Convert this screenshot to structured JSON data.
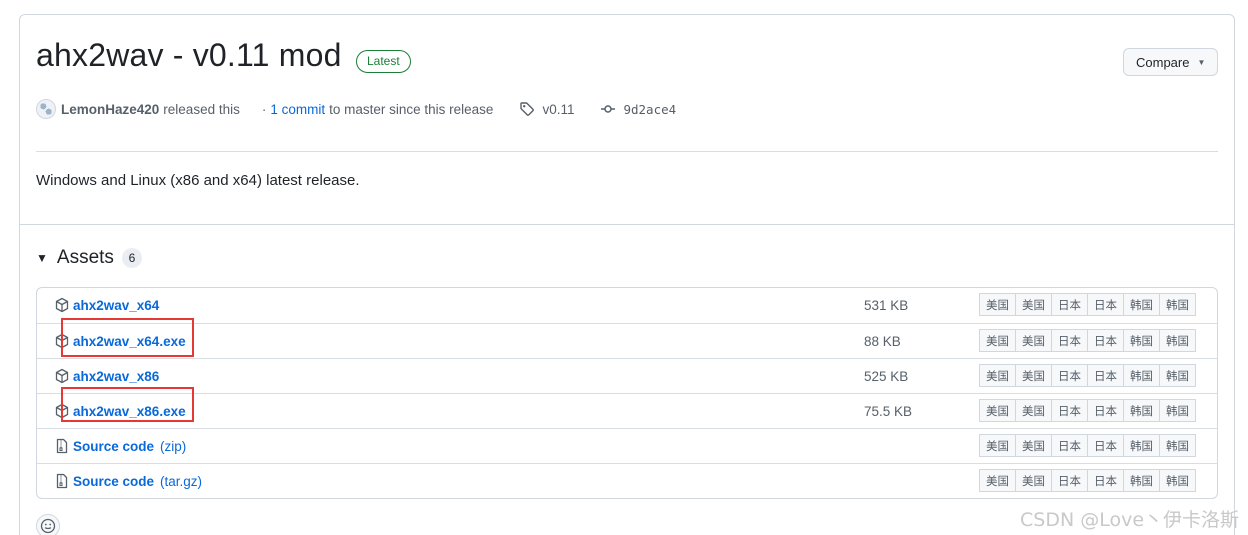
{
  "release": {
    "title": "ahx2wav - v0.11 mod",
    "badge": "Latest",
    "compare_label": "Compare",
    "author": "LemonHaze420",
    "released_text": "released this",
    "commits_link": "1 commit",
    "commits_suffix": "to master since this release",
    "tag": "v0.11",
    "commit_sha": "9d2ace4",
    "description": "Windows and Linux (x86 and x64) latest release."
  },
  "assets": {
    "heading": "Assets",
    "count": "6",
    "items": [
      {
        "name": "ahx2wav_x64",
        "ext": "",
        "size": "531 KB",
        "icon": "package-icon"
      },
      {
        "name": "ahx2wav_x64.exe",
        "ext": "",
        "size": "88 KB",
        "icon": "package-icon"
      },
      {
        "name": "ahx2wav_x86",
        "ext": "",
        "size": "525 KB",
        "icon": "package-icon"
      },
      {
        "name": "ahx2wav_x86.exe",
        "ext": "",
        "size": "75.5 KB",
        "icon": "package-icon"
      },
      {
        "name": "Source code",
        "ext": "(zip)",
        "size": "",
        "icon": "file-zip-icon"
      },
      {
        "name": "Source code",
        "ext": "(tar.gz)",
        "size": "",
        "icon": "file-zip-icon"
      }
    ],
    "mirror_buttons": [
      "美国",
      "美国",
      "日本",
      "日本",
      "韩国",
      "韩国"
    ]
  },
  "watermark": "CSDN @Love丶伊卡洛斯",
  "colors": {
    "link": "#0969da",
    "latest": "#1a7f37",
    "highlight": "#e53935",
    "border": "#d0d7de"
  }
}
